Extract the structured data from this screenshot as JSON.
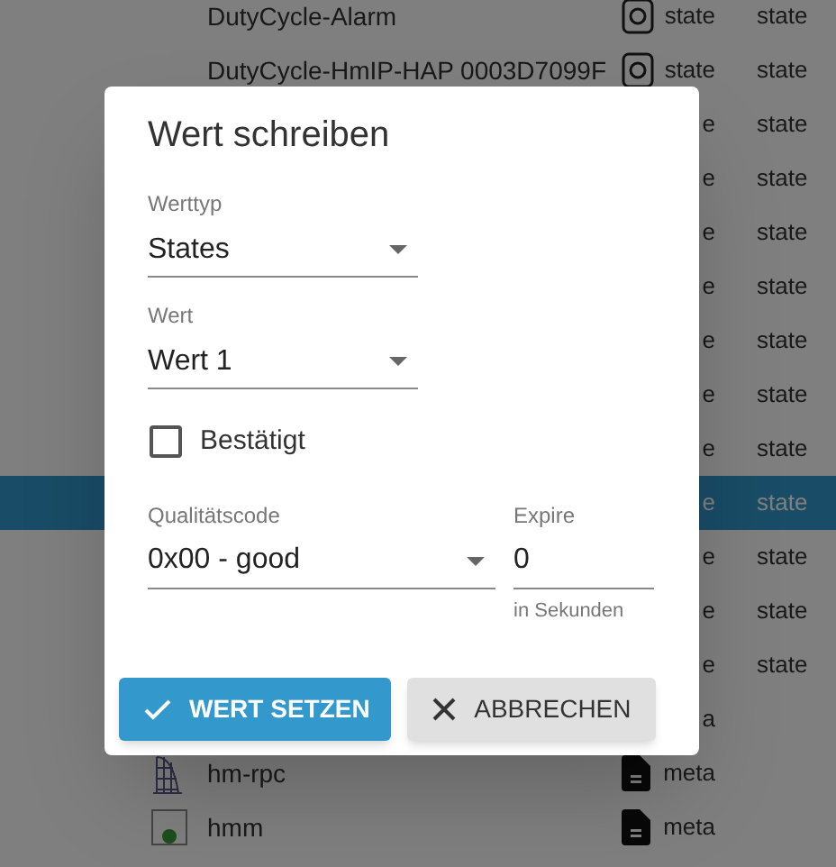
{
  "list": {
    "rows": [
      {
        "kind": "state",
        "name": "DutyCycle-Alarm",
        "type": "state",
        "role": "state",
        "selected": false
      },
      {
        "kind": "state",
        "name": "DutyCycle-HmIP-HAP 0003D7099F",
        "type": "state",
        "role": "state",
        "selected": false
      },
      {
        "type": "e",
        "role": "state",
        "selected": false
      },
      {
        "type": "e",
        "role": "state",
        "selected": false
      },
      {
        "type": "e",
        "role": "state",
        "selected": false
      },
      {
        "type": "e",
        "role": "state",
        "selected": false
      },
      {
        "type": "e",
        "role": "state",
        "selected": false
      },
      {
        "type": "e",
        "role": "state",
        "selected": false
      },
      {
        "type": "e",
        "role": "state",
        "selected": false
      },
      {
        "type": "e",
        "role": "state",
        "selected": true
      },
      {
        "type": "e",
        "role": "state",
        "selected": false
      },
      {
        "type": "e",
        "role": "state",
        "selected": false
      },
      {
        "type": "e",
        "role": "state",
        "selected": false
      },
      {
        "type": "a",
        "selected": false
      },
      {
        "kind": "adapter",
        "name": "hm-rpc",
        "type": "meta",
        "selected": false
      },
      {
        "kind": "instance",
        "name": "hmm",
        "type": "meta",
        "selected": false
      }
    ]
  },
  "dialog": {
    "title": "Wert schreiben",
    "value_type": {
      "label": "Werttyp",
      "value": "States"
    },
    "value": {
      "label": "Wert",
      "value": "Wert 1"
    },
    "acknowledged": {
      "label": "Bestätigt",
      "checked": false
    },
    "quality": {
      "label": "Qualitätscode",
      "value": "0x00 - good"
    },
    "expire": {
      "label": "Expire",
      "value": "0",
      "helper": "in Sekunden"
    },
    "buttons": [
      {
        "kind": "primary",
        "label": "WERT SETZEN"
      },
      {
        "kind": "secondary",
        "label": "ABBRECHEN"
      }
    ]
  }
}
